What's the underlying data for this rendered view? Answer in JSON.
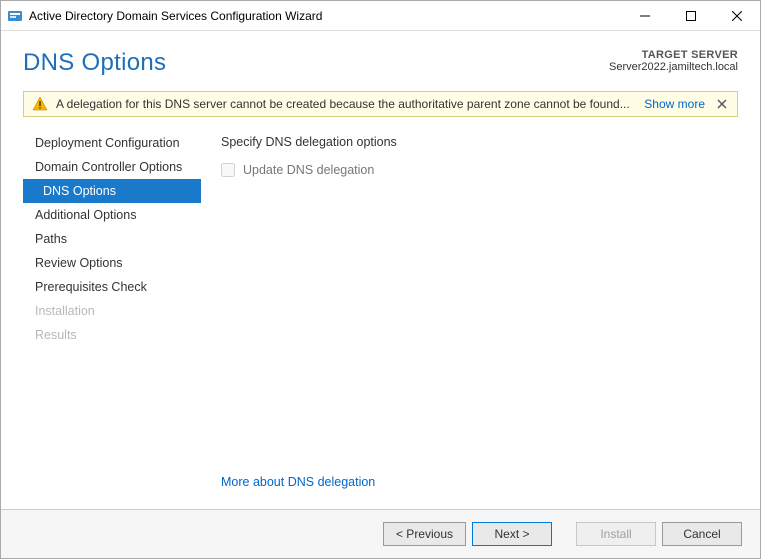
{
  "window": {
    "title": "Active Directory Domain Services Configuration Wizard"
  },
  "header": {
    "page_title": "DNS Options",
    "target_label": "TARGET SERVER",
    "target_value": "Server2022.jamiltech.local"
  },
  "warning": {
    "text": "A delegation for this DNS server cannot be created because the authoritative parent zone cannot be found...",
    "show_more": "Show more"
  },
  "nav": {
    "items": [
      {
        "label": "Deployment Configuration",
        "active": false,
        "disabled": false
      },
      {
        "label": "Domain Controller Options",
        "active": false,
        "disabled": false
      },
      {
        "label": "DNS Options",
        "active": true,
        "disabled": false,
        "indent": true
      },
      {
        "label": "Additional Options",
        "active": false,
        "disabled": false
      },
      {
        "label": "Paths",
        "active": false,
        "disabled": false
      },
      {
        "label": "Review Options",
        "active": false,
        "disabled": false
      },
      {
        "label": "Prerequisites Check",
        "active": false,
        "disabled": false
      },
      {
        "label": "Installation",
        "active": false,
        "disabled": true
      },
      {
        "label": "Results",
        "active": false,
        "disabled": true
      }
    ]
  },
  "content": {
    "section_label": "Specify DNS delegation options",
    "checkbox_label": "Update DNS delegation",
    "more_link": "More about DNS delegation"
  },
  "footer": {
    "previous": "< Previous",
    "next": "Next >",
    "install": "Install",
    "cancel": "Cancel"
  }
}
